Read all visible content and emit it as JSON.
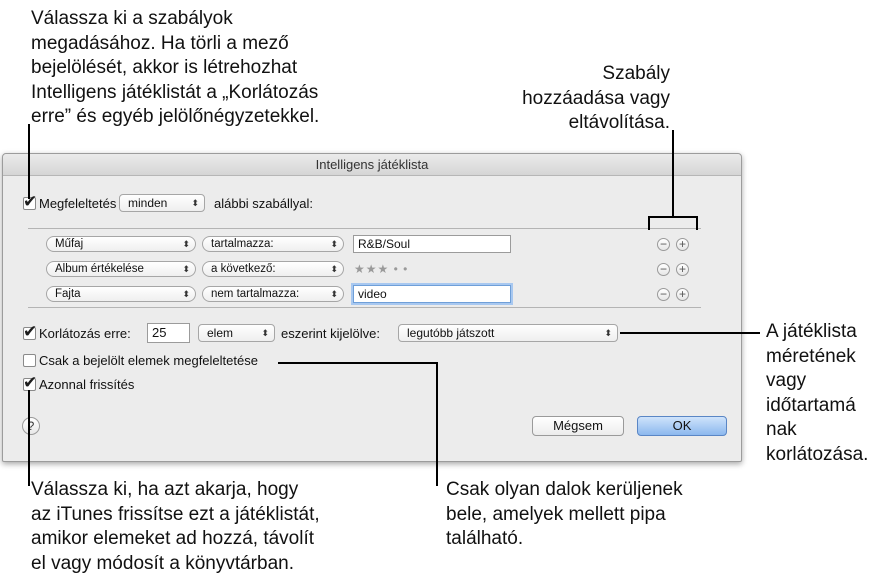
{
  "callouts": {
    "top_left": "Válassza ki a szabályok\nmegadásához. Ha törli a mező\nbejelölését, akkor is létrehozhat\nIntelligens játéklistát a „Korlátozás\nerre” és egyéb jelölőnégyzetekkel.",
    "top_right": "Szabály\nhozzáadása vagy\neltávolítása.",
    "right": "A játéklista\nméretének\nvagy\nidőtartamá\nnak\nkorlátozása.",
    "bottom_left": "Válassza ki, ha azt akarja, hogy\naz iTunes frissítse ezt a játéklistát,\namikor elemeket ad hozzá, távolít\nel vagy módosít a könyvtárban.",
    "bottom_right": "Csak olyan dalok kerüljenek\nbele, amelyek mellett pipa\ntalálható."
  },
  "dialog": {
    "title": "Intelligens játéklista",
    "match": {
      "checked": true,
      "label": "Megfeleltetés",
      "mode": "minden",
      "suffix": "alábbi szabállyal:"
    },
    "rules": [
      {
        "field": "Műfaj",
        "operator": "tartalmazza:",
        "value": "R&B/Soul",
        "type": "text"
      },
      {
        "field": "Album értékelése",
        "operator": "a következő:",
        "value": "★★★ • •",
        "type": "stars"
      },
      {
        "field": "Fajta",
        "operator": "nem tartalmazza:",
        "value": "video",
        "type": "text",
        "focused": true
      }
    ],
    "rule_buttons": {
      "remove": "−",
      "add": "+"
    },
    "limit": {
      "checked": true,
      "label": "Korlátozás erre:",
      "amount": "25",
      "unit": "elem",
      "sorted_label": "eszerint kijelölve:",
      "sorted_by": "legutóbb játszott"
    },
    "checked_only": {
      "checked": false,
      "label": "Csak a bejelölt elemek megfeleltetése"
    },
    "live_update": {
      "checked": true,
      "label": "Azonnal frissítés"
    },
    "buttons": {
      "help": "?",
      "cancel": "Mégsem",
      "ok": "OK"
    }
  },
  "icons": {
    "popup_arrows": "updown-arrows-icon",
    "check": "checkmark-icon"
  }
}
